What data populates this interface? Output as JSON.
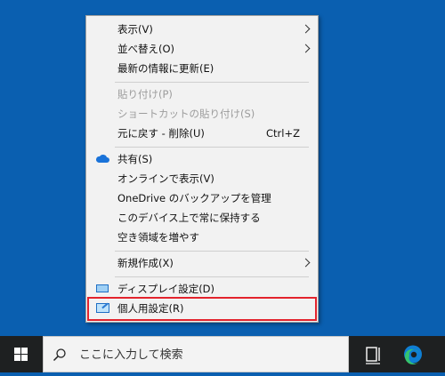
{
  "context_menu": {
    "items": [
      {
        "label": "表示(V)",
        "submenu": true
      },
      {
        "label": "並べ替え(O)",
        "submenu": true
      },
      {
        "label": "最新の情報に更新(E)"
      },
      {
        "label": "貼り付け(P)",
        "disabled": true
      },
      {
        "label": "ショートカットの貼り付け(S)",
        "disabled": true
      },
      {
        "label": "元に戻す - 削除(U)",
        "shortcut": "Ctrl+Z"
      },
      {
        "label": "共有(S)",
        "icon": "onedrive-cloud-icon"
      },
      {
        "label": "オンラインで表示(V)"
      },
      {
        "label": "OneDrive のバックアップを管理"
      },
      {
        "label": "このデバイス上で常に保持する"
      },
      {
        "label": "空き領域を増やす"
      },
      {
        "label": "新規作成(X)",
        "submenu": true
      },
      {
        "label": "ディスプレイ設定(D)",
        "icon": "display-settings-icon"
      },
      {
        "label": "個人用設定(R)",
        "icon": "personalize-icon",
        "highlighted": true
      }
    ]
  },
  "taskbar": {
    "search_placeholder": "ここに入力して検索"
  },
  "colors": {
    "desktop": "#0a5fb0",
    "menu_bg": "#f2f2f2",
    "highlight_border": "#e3232d",
    "taskbar": "#1e2021",
    "disabled_text": "#9c9c9c"
  }
}
